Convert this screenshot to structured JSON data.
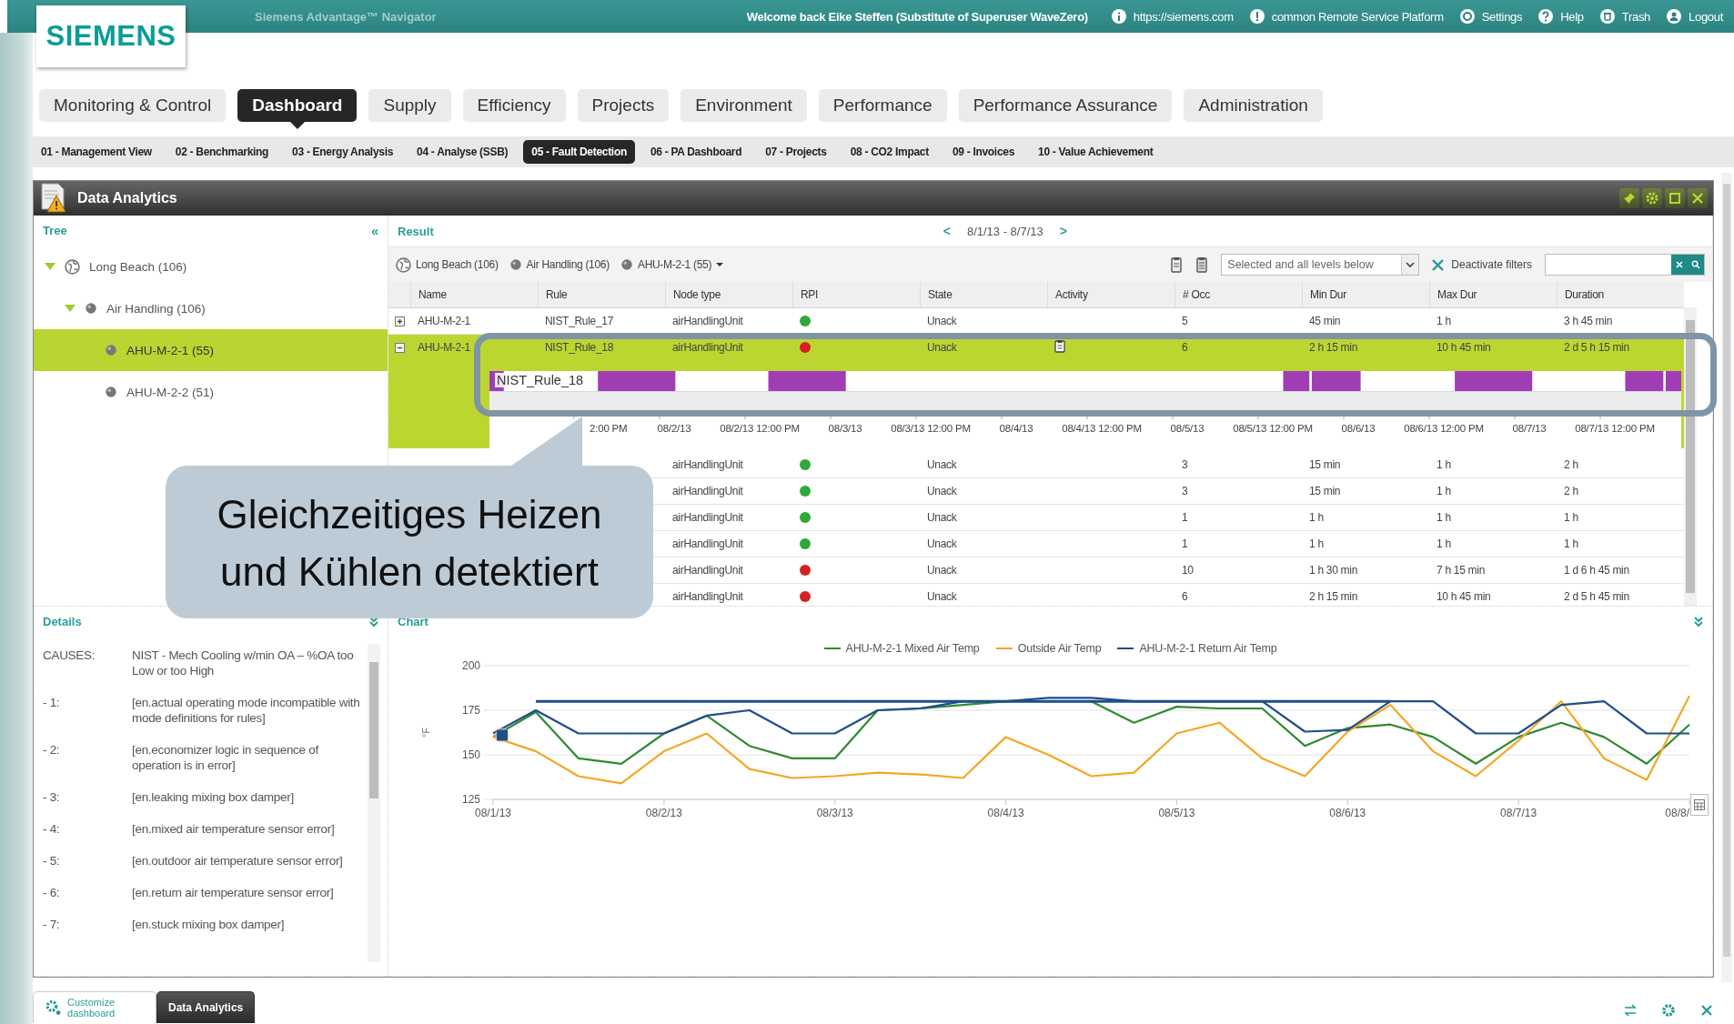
{
  "header": {
    "logo": "SIEMENS",
    "app_title": "Siemens Advantage™ Navigator",
    "welcome": "Welcome back Eike Steffen (Substitute of Superuser WaveZero)",
    "links": [
      {
        "kind": "info",
        "label": "https://siemens.com"
      },
      {
        "kind": "alert",
        "label": "common Remote Service Platform"
      },
      {
        "kind": "settings",
        "label": "Settings"
      },
      {
        "kind": "help",
        "label": "Help"
      },
      {
        "kind": "trash",
        "label": "Trash"
      },
      {
        "kind": "user",
        "label": "Logout"
      }
    ]
  },
  "main_tabs": [
    {
      "label": "Monitoring & Control",
      "selected": false
    },
    {
      "label": "Dashboard",
      "selected": true
    },
    {
      "label": "Supply",
      "selected": false
    },
    {
      "label": "Efficiency",
      "selected": false
    },
    {
      "label": "Projects",
      "selected": false
    },
    {
      "label": "Environment",
      "selected": false
    },
    {
      "label": "Performance",
      "selected": false
    },
    {
      "label": "Performance Assurance",
      "selected": false
    },
    {
      "label": "Administration",
      "selected": false
    }
  ],
  "sub_tabs": [
    {
      "label": "01 - Management View",
      "selected": false
    },
    {
      "label": "02 - Benchmarking",
      "selected": false
    },
    {
      "label": "03 - Energy Analysis",
      "selected": false
    },
    {
      "label": "04 - Analyse (SSB)",
      "selected": false
    },
    {
      "label": "05 - Fault Detection",
      "selected": true
    },
    {
      "label": "06 - PA Dashboard",
      "selected": false
    },
    {
      "label": "07 - Projects",
      "selected": false
    },
    {
      "label": "08 - CO2 Impact",
      "selected": false
    },
    {
      "label": "09 - Invoices",
      "selected": false
    },
    {
      "label": "10 - Value Achievement",
      "selected": false
    }
  ],
  "portlet": {
    "title": "Data Analytics"
  },
  "tree": {
    "title": "Tree",
    "collapse": "«",
    "items": [
      {
        "kind": "site",
        "label": "Long Beach (106)",
        "expanded": true,
        "selected": false,
        "children": [
          {
            "kind": "group",
            "label": "Air Handling (106)",
            "expanded": true,
            "selected": false,
            "children": [
              {
                "kind": "unit",
                "label": "AHU-M-2-1 (55)",
                "selected": true
              },
              {
                "kind": "unit",
                "label": "AHU-M-2-2 (51)",
                "selected": false
              }
            ]
          }
        ]
      }
    ]
  },
  "result": {
    "title": "Result",
    "prev": "<",
    "date_range": "8/1/13 - 8/7/13",
    "next": ">",
    "breadcrumb": [
      {
        "kind": "site",
        "label": "Long Beach (106)"
      },
      {
        "kind": "group",
        "label": "Air Handling (106)"
      },
      {
        "kind": "unit",
        "label": "AHU-M-2-1 (55)"
      }
    ],
    "scope_select": "Selected and all levels below",
    "deactivate": "Deactivate filters",
    "columns": [
      "Name",
      "Rule",
      "Node type",
      "RPI",
      "State",
      "Activity",
      "# Occ",
      "Min Dur",
      "Max Dur",
      "Duration"
    ],
    "rows": [
      {
        "expanded": false,
        "selected": false,
        "name": "AHU-M-2-1",
        "rule": "NIST_Rule_17",
        "node_type": "airHandlingUnit",
        "color": "#2fa83a",
        "state": "Unack",
        "activity": false,
        "occ": "5",
        "min_dur": "45 min",
        "max_dur": "1 h",
        "duration": "3 h 45 min"
      },
      {
        "expanded": true,
        "selected": true,
        "name": "AHU-M-2-1",
        "rule": "NIST_Rule_18",
        "node_type": "airHandlingUnit",
        "color": "#d61f1f",
        "state": "Unack",
        "activity": true,
        "occ": "6",
        "min_dur": "2 h 15 min",
        "max_dur": "10 h 45 min",
        "duration": "2 d 5 h 15 min",
        "timeline": {
          "label": "NIST_Rule_18",
          "ticks": [
            "2:00 PM",
            "08/2/13",
            "08/2/13 12:00 PM",
            "08/3/13",
            "08/3/13 12:00 PM",
            "08/4/13",
            "08/4/13 12:00 PM",
            "08/5/13",
            "08/5/13 12:00 PM",
            "08/6/13",
            "08/6/13 12:00 PM",
            "08/7/13",
            "08/7/13 12:00 PM"
          ]
        }
      },
      {
        "selected": false,
        "node_type": "airHandlingUnit",
        "color": "#2fa83a",
        "state": "Unack",
        "activity": false,
        "occ": "3",
        "min_dur": "15 min",
        "max_dur": "1 h",
        "duration": "2 h"
      },
      {
        "selected": false,
        "node_type": "airHandlingUnit",
        "color": "#2fa83a",
        "state": "Unack",
        "activity": false,
        "occ": "3",
        "min_dur": "15 min",
        "max_dur": "1 h",
        "duration": "2 h"
      },
      {
        "selected": false,
        "node_type": "airHandlingUnit",
        "color": "#2fa83a",
        "state": "Unack",
        "activity": false,
        "occ": "1",
        "min_dur": "1 h",
        "max_dur": "1 h",
        "duration": "1 h"
      },
      {
        "selected": false,
        "node_type": "airHandlingUnit",
        "color": "#2fa83a",
        "state": "Unack",
        "activity": false,
        "occ": "1",
        "min_dur": "1 h",
        "max_dur": "1 h",
        "duration": "1 h"
      },
      {
        "selected": false,
        "node_type": "airHandlingUnit",
        "color": "#d61f1f",
        "state": "Unack",
        "activity": false,
        "occ": "10",
        "min_dur": "1 h 30 min",
        "max_dur": "7 h 15 min",
        "duration": "1 d 6 h 45 min"
      },
      {
        "selected": false,
        "node_type": "airHandlingUnit",
        "color": "#d61f1f",
        "state": "Unack",
        "activity": false,
        "occ": "6",
        "min_dur": "2 h 15 min",
        "max_dur": "10 h 45 min",
        "duration": "2 d 5 h 45 min"
      }
    ]
  },
  "details": {
    "title": "Details",
    "causes": [
      {
        "key": "CAUSES:",
        "text": "NIST - Mech Cooling w/min OA – %OA too Low or too High"
      },
      {
        "key": "- 1:",
        "text": "[en.actual operating mode incompatible with mode definitions for rules]"
      },
      {
        "key": "- 2:",
        "text": "[en.economizer logic in sequence of operation is in error]"
      },
      {
        "key": "- 3:",
        "text": "[en.leaking mixing box damper]"
      },
      {
        "key": "- 4:",
        "text": "[en.mixed air temperature sensor error]"
      },
      {
        "key": "- 5:",
        "text": "[en.outdoor air temperature sensor error]"
      },
      {
        "key": "- 6:",
        "text": "[en.return air temperature sensor error]"
      },
      {
        "key": "- 7:",
        "text": "[en.stuck mixing box damper]"
      }
    ]
  },
  "chart": {
    "title": "Chart",
    "chart_data": {
      "type": "line",
      "ylabel": "°F",
      "ylim": [
        125,
        200
      ],
      "yticks": [
        125,
        150,
        175,
        200
      ],
      "categories": [
        "08/1/13",
        null,
        null,
        null,
        "08/2/13",
        null,
        null,
        null,
        "08/3/13",
        null,
        null,
        null,
        "08/4/13",
        null,
        null,
        null,
        "08/5/13",
        null,
        null,
        null,
        "08/6/13",
        null,
        null,
        null,
        "08/7/13",
        null,
        null,
        null,
        "08/8/"
      ],
      "series": [
        {
          "name": "AHU-M-2-1 Mixed Air Temp",
          "color": "#2e8b2e",
          "values": [
            160,
            174,
            148,
            145,
            162,
            172,
            155,
            148,
            148,
            175,
            176,
            178,
            180,
            180,
            180,
            168,
            177,
            176,
            176,
            155,
            165,
            167,
            160,
            145,
            160,
            168,
            160,
            145,
            167
          ]
        },
        {
          "name": "Outside Air Temp",
          "color": "#f5a623",
          "values": [
            160,
            152,
            138,
            134,
            152,
            162,
            142,
            137,
            138,
            140,
            139,
            137,
            160,
            150,
            138,
            140,
            162,
            168,
            148,
            138,
            163,
            178,
            152,
            138,
            158,
            180,
            148,
            136,
            183
          ]
        },
        {
          "name": "AHU-M-2-1 Return Air Temp",
          "color": "#1f4e8c",
          "values": [
            162,
            175,
            162,
            162,
            162,
            172,
            175,
            162,
            162,
            175,
            176,
            180,
            180,
            182,
            182,
            180,
            180,
            180,
            180,
            163,
            164,
            180,
            180,
            162,
            162,
            178,
            180,
            162,
            162
          ]
        },
        {
          "color": "#1f4e8c",
          "values": [
            null,
            180,
            180,
            180,
            180,
            180,
            180,
            180,
            180,
            180,
            180,
            180,
            180,
            180,
            180,
            180,
            180,
            180,
            180,
            180,
            180,
            180,
            null,
            null,
            null,
            null,
            null,
            null,
            null
          ]
        }
      ]
    }
  },
  "bottom_tabs": [
    {
      "kind": "customize",
      "label": "Customize dashboard",
      "selected": false
    },
    {
      "kind": "portlet",
      "label": "Data Analytics",
      "selected": true
    }
  ],
  "callout": {
    "text": "Gleichzeitiges Heizen und Kühlen detektiert"
  }
}
